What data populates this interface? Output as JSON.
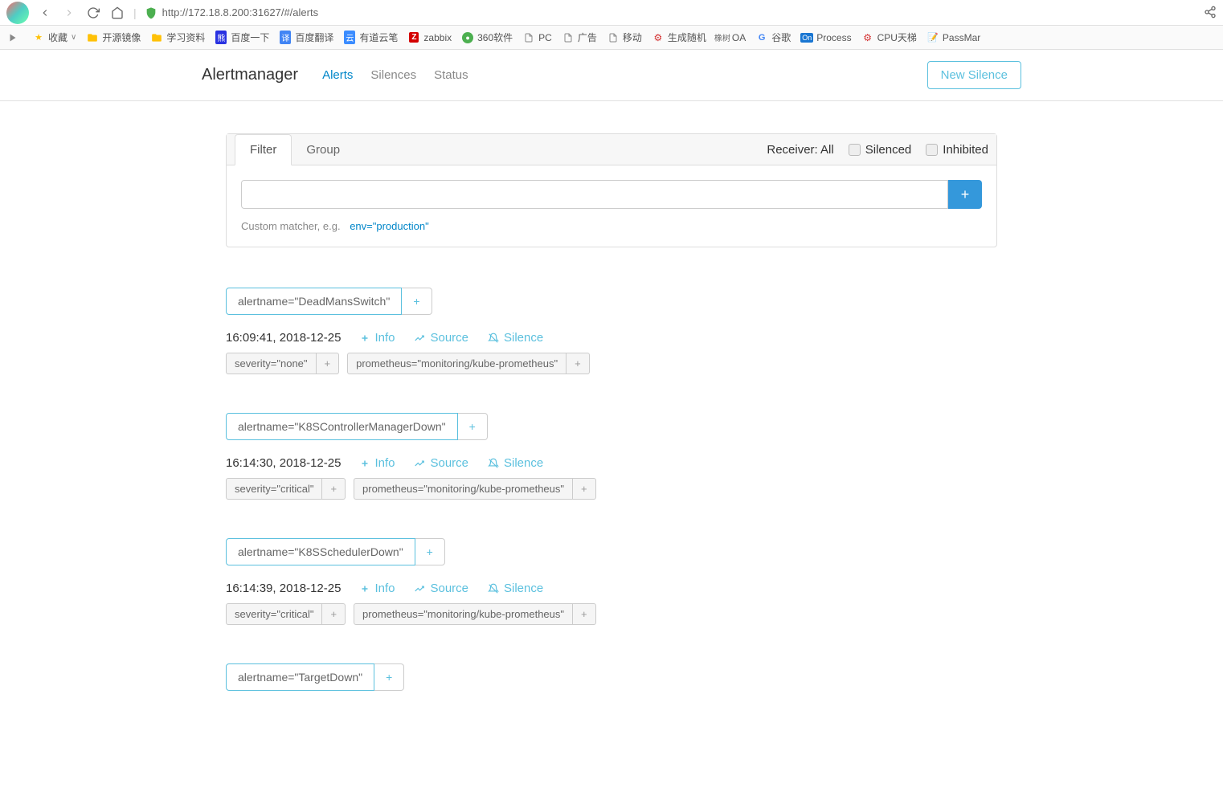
{
  "browser": {
    "url": "http://172.18.8.200:31627/#/alerts"
  },
  "bookmarks": [
    {
      "icon": "play",
      "label": ""
    },
    {
      "icon": "star",
      "label": "收藏"
    },
    {
      "icon": "folder",
      "label": "开源镜像"
    },
    {
      "icon": "folder",
      "label": "学习资料"
    },
    {
      "icon": "baidu",
      "label": "百度一下"
    },
    {
      "icon": "translate",
      "label": "百度翻译"
    },
    {
      "icon": "youdao",
      "label": "有道云笔"
    },
    {
      "icon": "zabbix",
      "label": "zabbix"
    },
    {
      "icon": "360",
      "label": "360软件"
    },
    {
      "icon": "page",
      "label": "PC"
    },
    {
      "icon": "page",
      "label": "广告"
    },
    {
      "icon": "page",
      "label": "移动"
    },
    {
      "icon": "gen",
      "label": "生成随机"
    },
    {
      "icon": "oa",
      "label": "OA"
    },
    {
      "icon": "google",
      "label": "谷歌"
    },
    {
      "icon": "process",
      "label": "Process"
    },
    {
      "icon": "cpu",
      "label": "CPU天梯"
    },
    {
      "icon": "passmark",
      "label": "PassMar"
    }
  ],
  "app": {
    "title": "Alertmanager",
    "nav": {
      "alerts": "Alerts",
      "silences": "Silences",
      "status": "Status"
    },
    "newSilence": "New Silence"
  },
  "filter": {
    "tabs": {
      "filter": "Filter",
      "group": "Group"
    },
    "receiver": "Receiver: All",
    "silenced": "Silenced",
    "inhibited": "Inhibited",
    "hint": "Custom matcher, e.g.",
    "example": "env=\"production\""
  },
  "actions": {
    "info": "Info",
    "source": "Source",
    "silence": "Silence"
  },
  "alerts": [
    {
      "alertname": "alertname=\"DeadMansSwitch\"",
      "time": "16:09:41, 2018-12-25",
      "labels": [
        "severity=\"none\"",
        "prometheus=\"monitoring/kube-prometheus\""
      ]
    },
    {
      "alertname": "alertname=\"K8SControllerManagerDown\"",
      "time": "16:14:30, 2018-12-25",
      "labels": [
        "severity=\"critical\"",
        "prometheus=\"monitoring/kube-prometheus\""
      ]
    },
    {
      "alertname": "alertname=\"K8SSchedulerDown\"",
      "time": "16:14:39, 2018-12-25",
      "labels": [
        "severity=\"critical\"",
        "prometheus=\"monitoring/kube-prometheus\""
      ]
    },
    {
      "alertname": "alertname=\"TargetDown\"",
      "time": "",
      "labels": []
    }
  ]
}
